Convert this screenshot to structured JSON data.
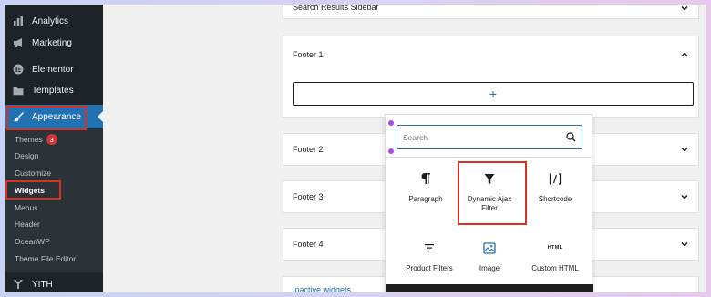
{
  "sidebar": {
    "items": [
      {
        "label": "Analytics",
        "icon": "bar-chart-icon"
      },
      {
        "label": "Marketing",
        "icon": "megaphone-icon"
      },
      {
        "label": "Elementor",
        "icon": "elementor-icon"
      },
      {
        "label": "Templates",
        "icon": "folder-icon"
      },
      {
        "label": "Appearance",
        "icon": "paintbrush-icon"
      }
    ],
    "submenu": [
      {
        "label": "Themes",
        "badge": "3"
      },
      {
        "label": "Design"
      },
      {
        "label": "Customize"
      },
      {
        "label": "Widgets"
      },
      {
        "label": "Menus"
      },
      {
        "label": "Header"
      },
      {
        "label": "OceanWP"
      },
      {
        "label": "Theme File Editor"
      }
    ],
    "bottom_item": {
      "label": "YITH",
      "icon": "yith-icon"
    }
  },
  "widget_areas": {
    "top_cut": "Search Results Sidebar",
    "footer1": "Footer 1",
    "footer2": "Footer 2",
    "footer3": "Footer 3",
    "footer4": "Footer 4",
    "inactive": "Inactive widgets",
    "add_block_symbol": "+"
  },
  "inserter": {
    "search_placeholder": "Search",
    "blocks": [
      {
        "label": "Paragraph",
        "icon": "paragraph-icon"
      },
      {
        "label": "Dynamic Ajax Filter",
        "icon": "filter-funnel-icon"
      },
      {
        "label": "Shortcode",
        "icon": "shortcode-icon"
      },
      {
        "label": "Product Filters",
        "icon": "product-filters-icon"
      },
      {
        "label": "Image",
        "icon": "image-icon"
      },
      {
        "label": "Custom HTML",
        "icon": "html-icon",
        "icon_text": "HTML"
      }
    ]
  },
  "colors": {
    "sidebar_bg": "#1d2327",
    "accent": "#2271b1",
    "highlight_box": "#d93025",
    "badge": "#d63638"
  }
}
